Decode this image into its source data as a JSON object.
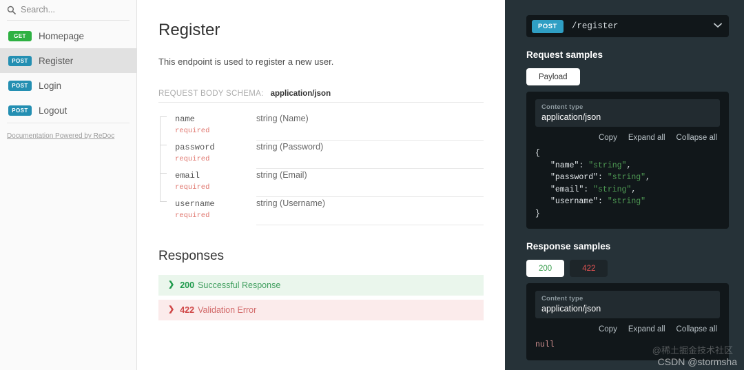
{
  "sidebar": {
    "search": {
      "placeholder": "Search...",
      "value": "",
      "icon": "search-icon"
    },
    "items": [
      {
        "method": "GET",
        "label": "Homepage",
        "active": false
      },
      {
        "method": "POST",
        "label": "Register",
        "active": true
      },
      {
        "method": "POST",
        "label": "Login",
        "active": false
      },
      {
        "method": "POST",
        "label": "Logout",
        "active": false
      }
    ],
    "footer_link": "Documentation Powered by ReDoc"
  },
  "content": {
    "title": "Register",
    "description": "This endpoint is used to register a new user.",
    "schema": {
      "label": "REQUEST BODY SCHEMA:",
      "value": "application/json",
      "fields": [
        {
          "name": "name",
          "required": "required",
          "type": "string (Name)"
        },
        {
          "name": "password",
          "required": "required",
          "type": "string (Password)"
        },
        {
          "name": "email",
          "required": "required",
          "type": "string (Email)"
        },
        {
          "name": "username",
          "required": "required",
          "type": "string (Username)"
        }
      ]
    },
    "responses_title": "Responses",
    "responses": [
      {
        "code": "200",
        "text": "Successful Response",
        "status": "ok",
        "chevron": "❯"
      },
      {
        "code": "422",
        "text": "Validation Error",
        "status": "err",
        "chevron": "❯"
      }
    ]
  },
  "right_panel": {
    "endpoint": {
      "method": "POST",
      "path": "/register",
      "chevron": "⌄"
    },
    "request_samples": {
      "title": "Request samples",
      "tabs": [
        {
          "label": "Payload",
          "active": true
        }
      ],
      "content_type_label": "Content type",
      "content_type_value": "application/json",
      "actions": [
        "Copy",
        "Expand all",
        "Collapse all"
      ],
      "code": {
        "open": "{",
        "lines": [
          {
            "key": "\"name\":",
            "value": "\"string\"",
            "comma": ","
          },
          {
            "key": "\"password\":",
            "value": "\"string\"",
            "comma": ","
          },
          {
            "key": "\"email\":",
            "value": "\"string\"",
            "comma": ","
          },
          {
            "key": "\"username\":",
            "value": "\"string\"",
            "comma": ""
          }
        ],
        "close": "}"
      }
    },
    "response_samples": {
      "title": "Response samples",
      "tabs": [
        {
          "label": "200",
          "active": true,
          "status": "ok"
        },
        {
          "label": "422",
          "active": false,
          "status": "err"
        }
      ],
      "content_type_label": "Content type",
      "content_type_value": "application/json",
      "actions": [
        "Copy",
        "Expand all",
        "Collapse all"
      ],
      "body": "null"
    }
  },
  "watermarks": {
    "one": "@稀土掘金技术社区",
    "two": "CSDN @stormsha"
  },
  "colors": {
    "get_badge": "#2eb142",
    "post_badge": "#248fb2",
    "endpoint_badge": "#2f9fc4",
    "panel_bg": "#263238",
    "code_bg": "#11171a",
    "ok": "#1f9a4c",
    "err": "#cf4545",
    "required": "#e0776f",
    "string_token": "#4f9b54"
  }
}
